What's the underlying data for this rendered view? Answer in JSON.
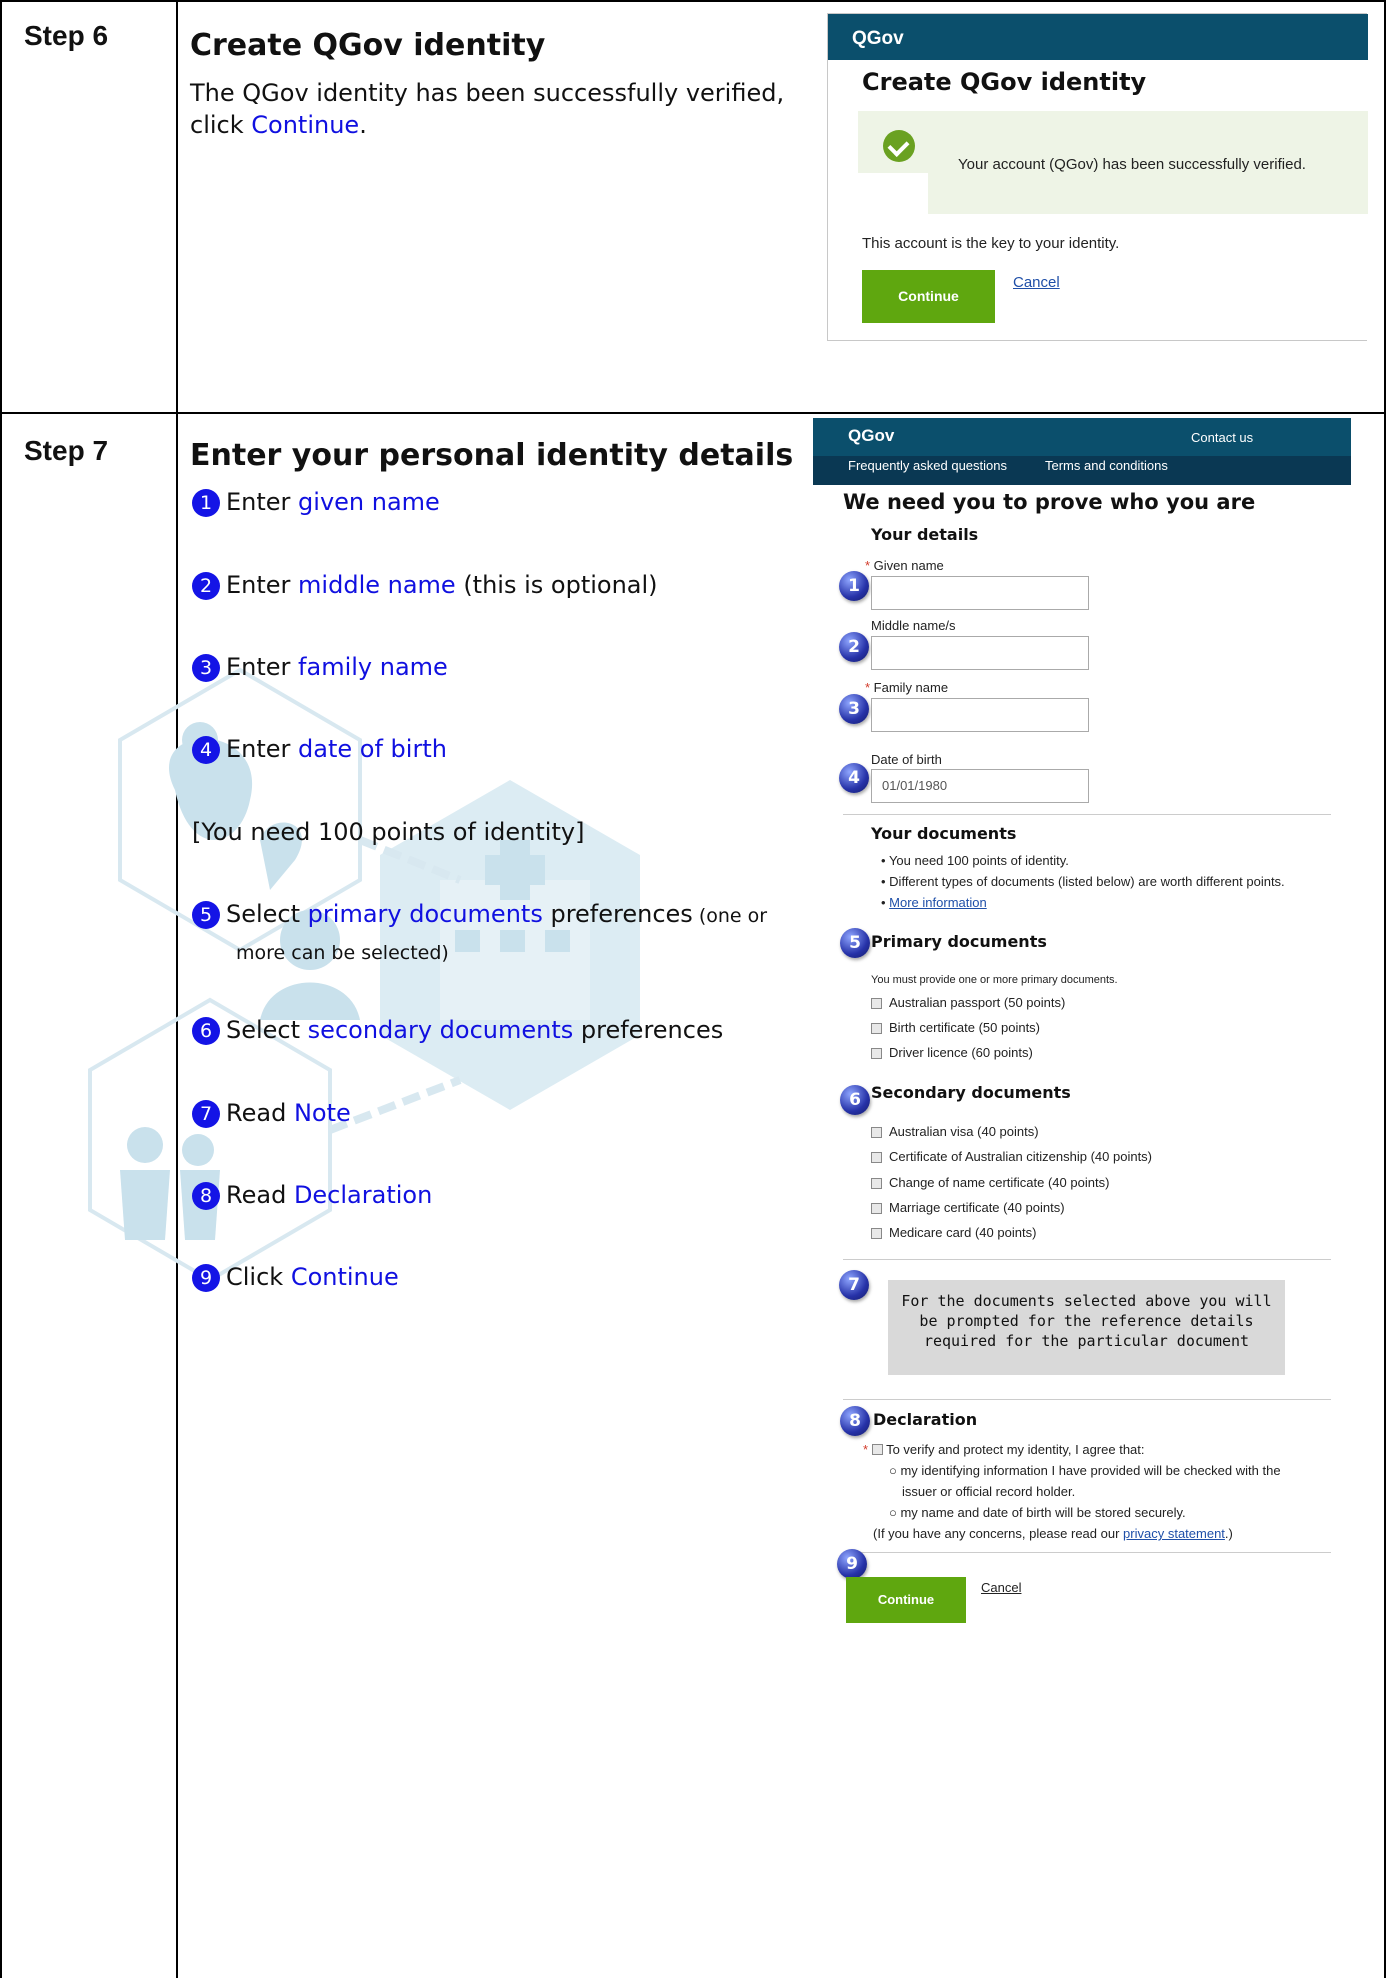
{
  "step6": {
    "label": "Step 6",
    "title": "Create QGov identity",
    "desc_line1": "The QGov identity has been successfully verified,",
    "desc_click": "click ",
    "desc_link": "Continue",
    "desc_end": ".",
    "shot": {
      "brand": "QGov",
      "title": "Create QGov identity",
      "success_message": "Your account (QGov) has been successfully verified.",
      "key_text": "This account is the key to your identity.",
      "continue_label": "Continue",
      "cancel_label": "Cancel"
    }
  },
  "step7": {
    "label": "Step 7",
    "title": "Enter your personal identity details",
    "instructions": [
      {
        "num": "1",
        "pre": "Enter ",
        "link": "given name",
        "post": ""
      },
      {
        "num": "2",
        "pre": "Enter ",
        "link": "middle name",
        "post": " (this is optional)"
      },
      {
        "num": "3",
        "pre": "Enter ",
        "link": "family name",
        "post": ""
      },
      {
        "num": "4",
        "pre": "Enter ",
        "link": "date of birth",
        "post": ""
      },
      {
        "num": "5",
        "pre": "Select ",
        "link": "primary documents",
        "post": " preferences",
        "small": " (one or",
        "small2": "more can be selected)"
      },
      {
        "num": "6",
        "pre": "Select ",
        "link": "secondary documents",
        "post": " preferences"
      },
      {
        "num": "7",
        "pre": "Read ",
        "link": "Note",
        "post": ""
      },
      {
        "num": "8",
        "pre": "Read ",
        "link": "Declaration",
        "post": ""
      },
      {
        "num": "9",
        "pre": "Click ",
        "link": "Continue",
        "post": ""
      }
    ],
    "points_note": "[You need 100 points of identity]",
    "shot": {
      "brand": "QGov",
      "contact": "Contact us",
      "faq": "Frequently asked questions",
      "terms": "Terms and conditions",
      "heading": "We need you to prove who you are",
      "your_details": "Your details",
      "given_label": "Given name",
      "middle_label": "Middle name/s",
      "family_label": "Family name",
      "dob_label": "Date of birth",
      "dob_value": "01/01/1980",
      "your_documents": "Your documents",
      "doc_bullets": [
        "You need 100 points of identity.",
        "Different types of documents (listed below) are worth different points.",
        "More information"
      ],
      "primary_heading": "Primary documents",
      "primary_note": "You must provide one or more primary documents.",
      "primary_docs": [
        "Australian passport (50 points)",
        "Birth certificate (50 points)",
        "Driver licence (60 points)"
      ],
      "secondary_heading": "Secondary documents",
      "secondary_docs": [
        "Australian visa (40 points)",
        "Certificate of Australian citizenship (40 points)",
        "Change of name certificate (40 points)",
        "Marriage certificate (40 points)",
        "Medicare card (40 points)"
      ],
      "note_text": [
        "For the documents selected above you will",
        "be prompted for the reference details",
        "required for the particular document"
      ],
      "declaration_heading": "Declaration",
      "declaration_agree": "To verify and protect my identity, I agree that:",
      "declaration_items": [
        "my identifying information I have provided will be checked with the",
        "issuer or official record holder.",
        "my name and date of birth will be stored securely."
      ],
      "concerns_pre": "(If you have any concerns, please read our ",
      "concerns_link": "privacy statement",
      "concerns_post": ".)",
      "continue_label": "Continue",
      "cancel_label": "Cancel",
      "ball_numbers": [
        "1",
        "2",
        "3",
        "4",
        "5",
        "6",
        "7",
        "8",
        "9"
      ]
    }
  }
}
